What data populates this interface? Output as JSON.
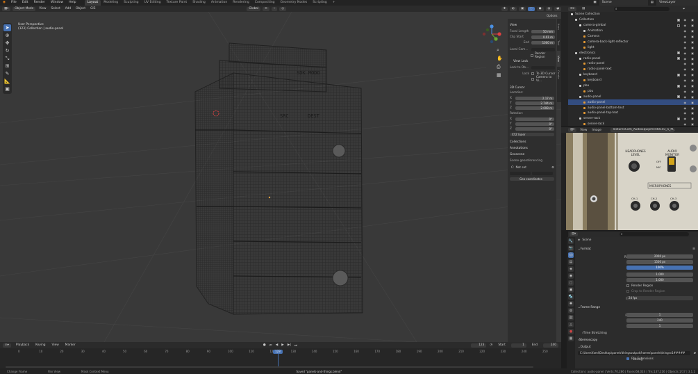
{
  "menubar": {
    "menus": [
      "File",
      "Edit",
      "Render",
      "Window",
      "Help"
    ],
    "workspaces": [
      "Layout",
      "Modeling",
      "Sculpting",
      "UV Editing",
      "Texture Paint",
      "Shading",
      "Animation",
      "Rendering",
      "Compositing",
      "Geometry Nodes",
      "Scripting"
    ],
    "active_workspace": "Layout",
    "scene": "Scene",
    "view_layer": "ViewLayer"
  },
  "viewport_header": {
    "mode": "Object Mode",
    "menus": [
      "View",
      "Select",
      "Add",
      "Object",
      "GIS"
    ],
    "orientation": "Global",
    "options": "Options"
  },
  "viewport": {
    "info_line1": "User Perspective",
    "info_line2": "(123) Collection | audio-panel",
    "model_label1": "SDK MODO",
    "model_label2": "SRC",
    "model_label3": "DEST"
  },
  "npanel": {
    "tabs": [
      "Item",
      "Tool",
      "View",
      "Create"
    ],
    "active_tab": "View",
    "view_title": "View",
    "focal_label": "Focal Length",
    "focal_value": "50 mm",
    "clip_start_label": "Clip Start",
    "clip_start_value": "0.01 m",
    "end_label": "End",
    "end_value": "1000 m",
    "local_camera_label": "Local Cam...",
    "render_region_label": "Render Region",
    "view_lock_title": "View Lock",
    "lock_to_obj_label": "Lock to Ob...",
    "lock_label": "Lock",
    "to_3d_cursor_label": "To 3D Cursor",
    "camera_to_view_label": "Camera to Vi...",
    "cursor_title": "3D Cursor",
    "location_label": "Location:",
    "loc_x": "2.17 m",
    "loc_y": "2.744 m",
    "loc_z": "2.608 m",
    "rotation_label": "Rotation:",
    "rot_x": "0°",
    "rot_y": "0°",
    "rot_z": "0°",
    "rotation_mode": "XYZ Euler",
    "collections_title": "Collections",
    "annotations_title": "Annotations",
    "geoscene_title": "Geoscene",
    "scene_geo_label": "Scene georeferencing",
    "crs_label": "Not set",
    "georef_button": "Geo coordinates"
  },
  "timeline": {
    "menus": [
      "Playback",
      "Keying",
      "View",
      "Marker"
    ],
    "current_frame": "123",
    "start_label": "Start",
    "start": "1",
    "end_label": "End",
    "end": "240",
    "ticks": [
      "0",
      "10",
      "20",
      "30",
      "40",
      "50",
      "60",
      "70",
      "80",
      "90",
      "100",
      "110",
      "120",
      "130",
      "140",
      "150",
      "160",
      "170",
      "180",
      "190",
      "200",
      "210",
      "220",
      "230",
      "240",
      "250"
    ]
  },
  "outliner": {
    "title": "Scene Collection",
    "items": [
      {
        "label": "Collection",
        "indent": 1,
        "color": "#cccccc",
        "checked": true
      },
      {
        "label": "camera-gimbal",
        "indent": 2,
        "color": "#e5e5e5",
        "checked": false
      },
      {
        "label": "Animation",
        "indent": 3,
        "color": "#cccccc",
        "checked": false
      },
      {
        "label": "Camera",
        "indent": 3,
        "color": "#e59a33",
        "checked": false
      },
      {
        "label": "camera-back-light-reflector",
        "indent": 3,
        "color": "#e59a33",
        "checked": false
      },
      {
        "label": "light",
        "indent": 3,
        "color": "#e59a33",
        "checked": false
      },
      {
        "label": "electronics",
        "indent": 1,
        "color": "#cccccc",
        "checked": true
      },
      {
        "label": "radio-panel",
        "indent": 2,
        "color": "#cccccc",
        "checked": true
      },
      {
        "label": "radio-panel",
        "indent": 3,
        "color": "#e59a33",
        "checked": false
      },
      {
        "label": "radio-panel-text",
        "indent": 3,
        "color": "#e59a33",
        "checked": false
      },
      {
        "label": "keyboard",
        "indent": 2,
        "color": "#cccccc",
        "checked": true
      },
      {
        "label": "keyboard",
        "indent": 3,
        "color": "#e59a33",
        "checked": false
      },
      {
        "label": "pbu",
        "indent": 2,
        "color": "#cccccc",
        "checked": true
      },
      {
        "label": "pbu",
        "indent": 3,
        "color": "#e59a33",
        "checked": false
      },
      {
        "label": "audio-panel",
        "indent": 2,
        "color": "#cccccc",
        "checked": true
      },
      {
        "label": "audio-panel",
        "indent": 3,
        "color": "#e59a33",
        "checked": false
      },
      {
        "label": "audio-panel-bottom-text",
        "indent": 3,
        "color": "#e59a33",
        "checked": false
      },
      {
        "label": "audio-panel-top-text",
        "indent": 3,
        "color": "#e59a33",
        "checked": false
      },
      {
        "label": "server-rack",
        "indent": 2,
        "color": "#cccccc",
        "checked": true
      },
      {
        "label": "server-rack",
        "indent": 3,
        "color": "#e59a33",
        "checked": false
      }
    ]
  },
  "image_editor": {
    "menus": [
      "View",
      "Image"
    ],
    "image_name": "TexturesCom_AudioEquipment0103_5_M.jpg",
    "photo_label1": "HEADPHONES LEVEL",
    "photo_label2": "AUDIO MONITOR",
    "photo_label3": "MICROPHONES",
    "photo_label4": "CH-1",
    "photo_label5": "CH-2",
    "photo_label6": "CH-3",
    "photo_label7": "OFF",
    "photo_label8": "MIC"
  },
  "properties": {
    "scene_label": "Scene",
    "format_title": "Format",
    "res_x_label": "Resolution X",
    "res_x": "2000 px",
    "res_y_label": "Y",
    "res_y": "1500 px",
    "pct_label": "%",
    "pct": "100%",
    "aspect_x_label": "Aspect X",
    "aspect_x": "1.000",
    "aspect_y_label": "Y",
    "aspect_y": "1.000",
    "render_region": "Render Region",
    "crop": "Crop to Render Region",
    "frame_rate_label": "Frame Rate",
    "frame_rate": "24 fps",
    "frame_range_title": "Frame Range",
    "frame_start_label": "Frame Start",
    "frame_start": "1",
    "end_label": "End",
    "end": "240",
    "step_label": "Step",
    "step": "1",
    "time_stretching": "Time Stretching",
    "stereoscopy": "Stereoscopy",
    "output_title": "Output",
    "output_path": "C:\\Users\\faml\\Desktop\\panels\\thingsoutput\\frames\\panels\\thingsv1#####",
    "saving_label": "Saving",
    "file_extensions": "File Extensions"
  },
  "statusbar": {
    "hint1": "Change Frame",
    "hint2": "Pan View",
    "hint3": "Mask Context Menu",
    "saved": "Saved \"panels-and-things.blend\"",
    "stats": "Collection | audio-panel | Verts:70,286 | Faces:68,024 | Tris:137,216 | Objects:1/17 | 3.1.2"
  }
}
